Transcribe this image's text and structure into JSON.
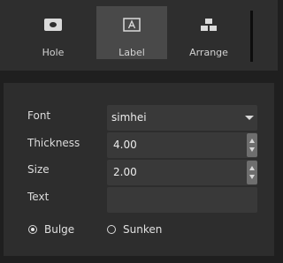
{
  "toolbar": {
    "buttons": [
      {
        "label": "Hole",
        "icon": "hole-icon"
      },
      {
        "label": "Label",
        "icon": "label-icon",
        "active": true
      },
      {
        "label": "Arrange",
        "icon": "arrange-icon"
      }
    ]
  },
  "panel": {
    "font": {
      "label": "Font",
      "value": "simhei"
    },
    "thickness": {
      "label": "Thickness",
      "value": "4.00"
    },
    "size": {
      "label": "Size",
      "value": "2.00"
    },
    "text": {
      "label": "Text",
      "value": ""
    },
    "style": {
      "options": [
        {
          "label": "Bulge",
          "checked": true
        },
        {
          "label": "Sunken",
          "checked": false
        }
      ]
    }
  },
  "colors": {
    "background": "#1f1f1f",
    "toolbar": "#2e2e2e",
    "active_button": "#494949",
    "panel": "#2d2d2d",
    "field": "#393939",
    "text": "#dcdcdc"
  }
}
